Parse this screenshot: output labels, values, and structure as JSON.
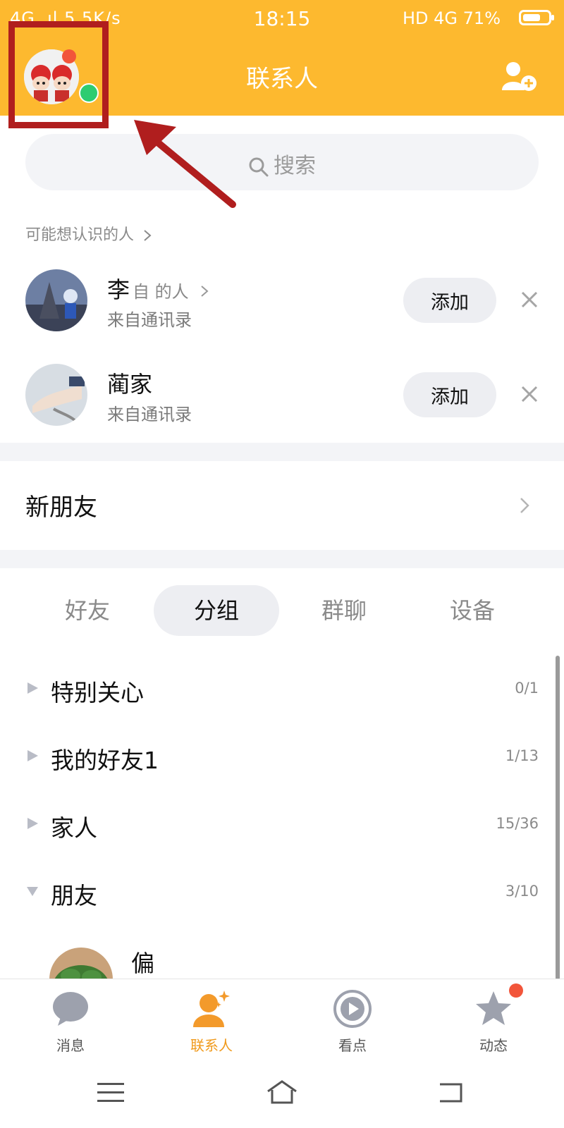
{
  "status_bar": {
    "left": "4G .ıl  5.5K/s",
    "time": "18:15",
    "right": "HD 4G  71%",
    "battery_level": 0.71
  },
  "header": {
    "title": "联系人",
    "accent_color": "#FDB92F"
  },
  "search": {
    "placeholder": "搜索"
  },
  "suggestions": {
    "label": "可能想认识的人",
    "items": [
      {
        "name": "李",
        "extra": "自 的人",
        "source": "来自通讯录",
        "action": "添加"
      },
      {
        "name": "蔺家",
        "extra": "",
        "source": "来自通讯录",
        "action": "添加"
      }
    ]
  },
  "new_friends": {
    "label": "新朋友"
  },
  "tabs": [
    {
      "label": "好友",
      "active": false
    },
    {
      "label": "分组",
      "active": true
    },
    {
      "label": "群聊",
      "active": false
    },
    {
      "label": "设备",
      "active": false
    }
  ],
  "groups": [
    {
      "name": "特别关心",
      "count": "0/1",
      "expanded": false
    },
    {
      "name": "我的好友1",
      "count": "1/13",
      "expanded": false
    },
    {
      "name": "家人",
      "count": "15/36",
      "expanded": false
    },
    {
      "name": "朋友",
      "count": "3/10",
      "expanded": true
    }
  ],
  "friend_preview": {
    "name": "偏"
  },
  "bottom_nav": [
    {
      "label": "消息",
      "icon": "message-bubble-icon",
      "active": false
    },
    {
      "label": "联系人",
      "icon": "contacts-person-icon",
      "active": true
    },
    {
      "label": "看点",
      "icon": "play-circle-icon",
      "active": false
    },
    {
      "label": "动态",
      "icon": "star-icon",
      "active": false,
      "badge": true
    }
  ]
}
